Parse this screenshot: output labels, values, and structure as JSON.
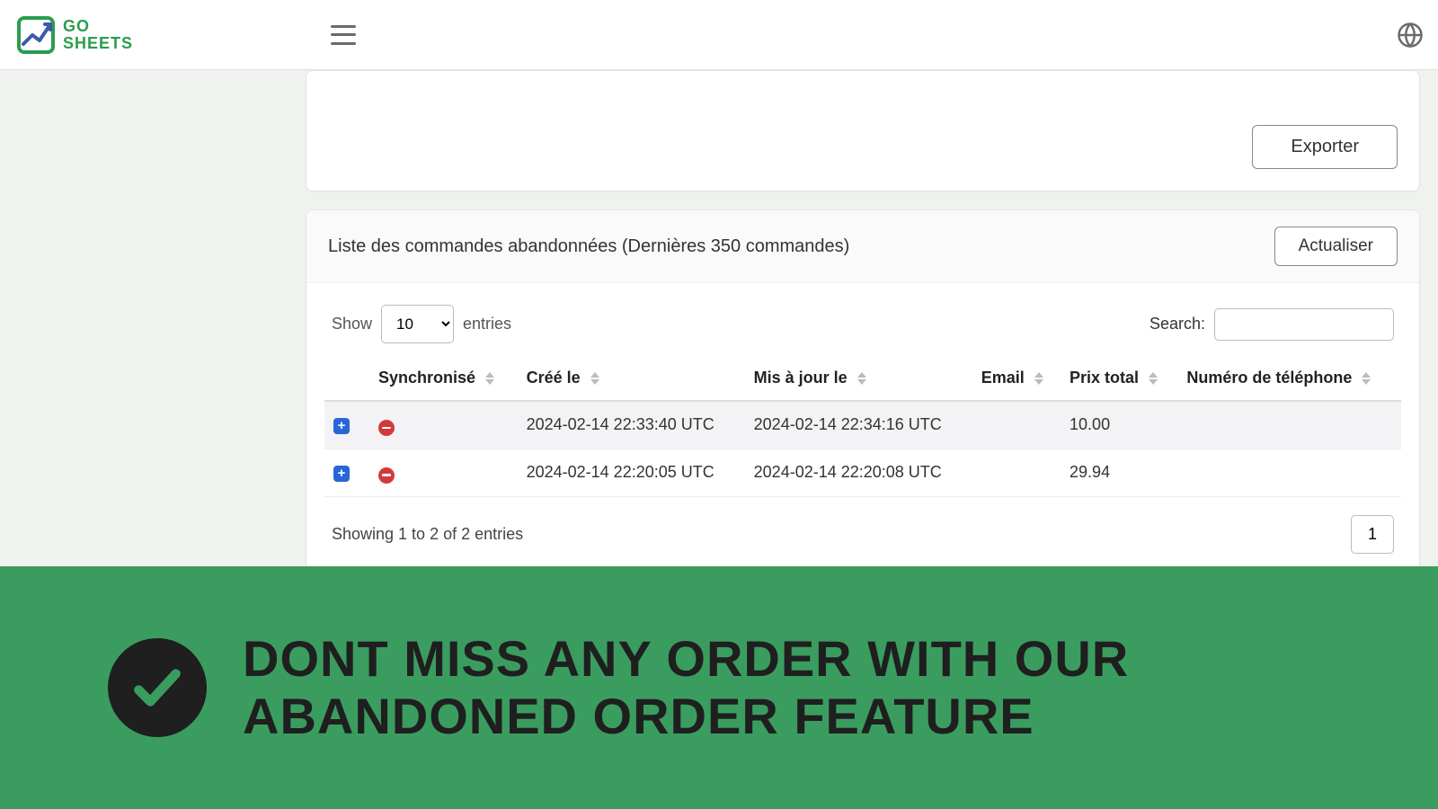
{
  "brand": {
    "line1": "GO",
    "line2": "SHEETS"
  },
  "export": {
    "label": "Exporter"
  },
  "list": {
    "title": "Liste des commandes abandonnées (Dernières 350 commandes)",
    "refresh": "Actualiser",
    "show_label_before": "Show",
    "show_label_after": "entries",
    "page_size": "10",
    "search_label": "Search:",
    "columns": {
      "sync": "Synchronisé",
      "created": "Créé le",
      "updated": "Mis à jour le",
      "email": "Email",
      "total": "Prix total",
      "phone": "Numéro de téléphone"
    },
    "rows": [
      {
        "created": "2024-02-14 22:33:40 UTC",
        "updated": "2024-02-14 22:34:16 UTC",
        "email": "",
        "total": "10.00",
        "phone": ""
      },
      {
        "created": "2024-02-14 22:20:05 UTC",
        "updated": "2024-02-14 22:20:08 UTC",
        "email": "",
        "total": "29.94",
        "phone": ""
      }
    ],
    "info": "Showing 1 to 2 of 2 entries",
    "page": "1"
  },
  "banner": {
    "text": "DONT MISS ANY ORDER WITH OUR ABANDONED ORDER FEATURE"
  }
}
